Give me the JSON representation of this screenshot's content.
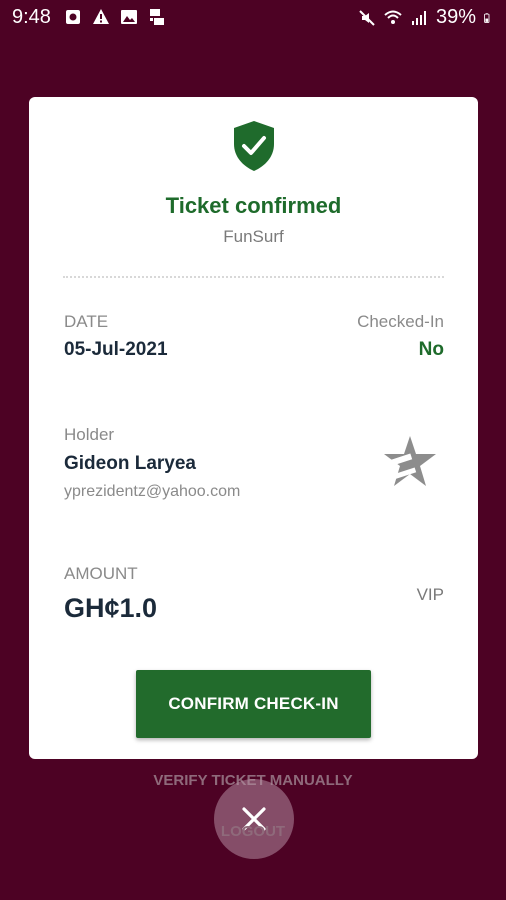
{
  "status_bar": {
    "time": "9:48",
    "battery": "39%"
  },
  "ticket": {
    "title": "Ticket confirmed",
    "event": "FunSurf",
    "date_label": "DATE",
    "date_value": "05-Jul-2021",
    "checked_in_label": "Checked-In",
    "checked_in_value": "No",
    "holder_label": "Holder",
    "holder_name": "Gideon Laryea",
    "holder_email": "yprezidentz@yahoo.com",
    "amount_label": "AMOUNT",
    "amount_value": "GH¢1.0",
    "tier": "VIP"
  },
  "actions": {
    "confirm_label": "CONFIRM CHECK-IN",
    "verify_manual_label": "VERIFY TICKET MANUALLY",
    "logout_label": "LOGOUT"
  },
  "icons": {
    "shield": "shield-check-icon",
    "tier": "star-icon",
    "close": "close-icon"
  },
  "colors": {
    "background": "#4d0224",
    "accent_green": "#226b2c",
    "title_green": "#1e6b2b"
  }
}
